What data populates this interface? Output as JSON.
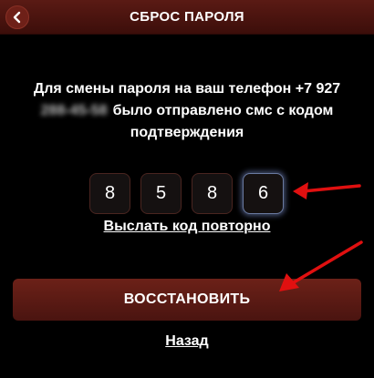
{
  "header": {
    "title": "СБРОС ПАРОЛЯ",
    "back_icon": "chevron-left-icon"
  },
  "message": {
    "line1": "Для смены пароля на ваш телефон +7 927",
    "masked_number": "288-45-58",
    "line2": "было отправлено смс с кодом",
    "line3": "подтверждения"
  },
  "code": {
    "digits": [
      "8",
      "5",
      "8",
      "6"
    ]
  },
  "resend_label": "Выслать код повторно",
  "restore_label": "ВОССТАНОВИТЬ",
  "back_label": "Назад",
  "colors": {
    "header_bg": "#4a1410",
    "button_bg": "#5a1a14",
    "arrow": "#e01010",
    "focus_glow": "#6a7aa0"
  }
}
